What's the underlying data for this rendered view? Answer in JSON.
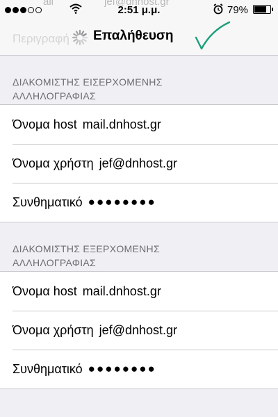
{
  "status_bar": {
    "signal_bars_filled": 3,
    "signal_bars_total": 5,
    "time": "2:51 μ.μ.",
    "battery_percent_text": "79%",
    "battery_level": 0.79,
    "icons": [
      "signal-dots-icon",
      "wifi-icon",
      "alarm-clock-icon",
      "battery-icon"
    ]
  },
  "nav": {
    "title": "Επαλήθευση",
    "ghost_text": "Περιγραφή",
    "ghost_top_left": "ail",
    "ghost_top_right": "jef@dnhost.gr"
  },
  "incoming": {
    "header_line1": "ΔΙΑΚΟΜΙΣΤΗΣ ΕΙΣΕΡΧΟΜΕΝΗΣ",
    "header_line2": "ΑΛΛΗΛΟΓΡΑΦΙΑΣ",
    "rows": [
      {
        "label": "Όνομα host",
        "value": "mail.dnhost.gr"
      },
      {
        "label": "Όνομα χρήστη",
        "value": "jef@dnhost.gr"
      },
      {
        "label": "Συνθηματικό",
        "value": "●●●●●●●●"
      }
    ]
  },
  "outgoing": {
    "header_line1": "ΔΙΑΚΟΜΙΣΤΗΣ ΕΞΕΡΧΟΜΕΝΗΣ",
    "header_line2": "ΑΛΛΗΛΟΓΡΑΦΙΑΣ",
    "rows": [
      {
        "label": "Όνομα host",
        "value": "mail.dnhost.gr"
      },
      {
        "label": "Όνομα χρήστη",
        "value": "jef@dnhost.gr"
      },
      {
        "label": "Συνθηματικό",
        "value": "●●●●●●●●"
      }
    ]
  },
  "colors": {
    "background": "#efeff4",
    "bar": "#f7f7f7",
    "separator": "#c8c7cc",
    "header_text": "#6d6d72",
    "checkmark": "#1aa07a"
  }
}
